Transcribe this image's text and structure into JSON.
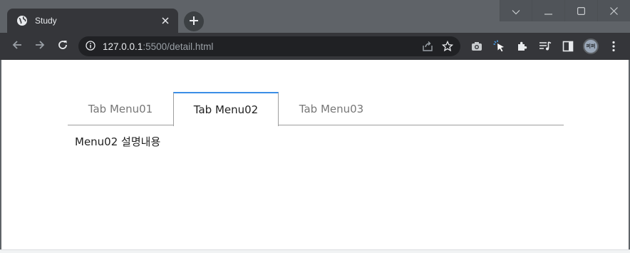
{
  "browser": {
    "tab": {
      "title": "Study",
      "favicon": "globe-icon",
      "close_icon": "close-icon"
    },
    "new_tab_icon": "plus-icon",
    "window_controls": [
      "chevron-down-icon",
      "minimize-icon",
      "maximize-icon",
      "close-icon"
    ],
    "address": {
      "host": "127.0.0.1",
      "rest": ":5500/detail.html"
    },
    "avatar_text": "퍼퍼"
  },
  "tabs": {
    "items": [
      {
        "label": "Tab Menu01",
        "active": false
      },
      {
        "label": "Tab Menu02",
        "active": true
      },
      {
        "label": "Tab Menu03",
        "active": false
      }
    ],
    "content": "Menu02 설명내용"
  },
  "colors": {
    "accent": "#3a8ee6",
    "tab_inactive_text": "#777777",
    "tab_active_text": "#222222",
    "chrome_dark": "#35363a"
  }
}
